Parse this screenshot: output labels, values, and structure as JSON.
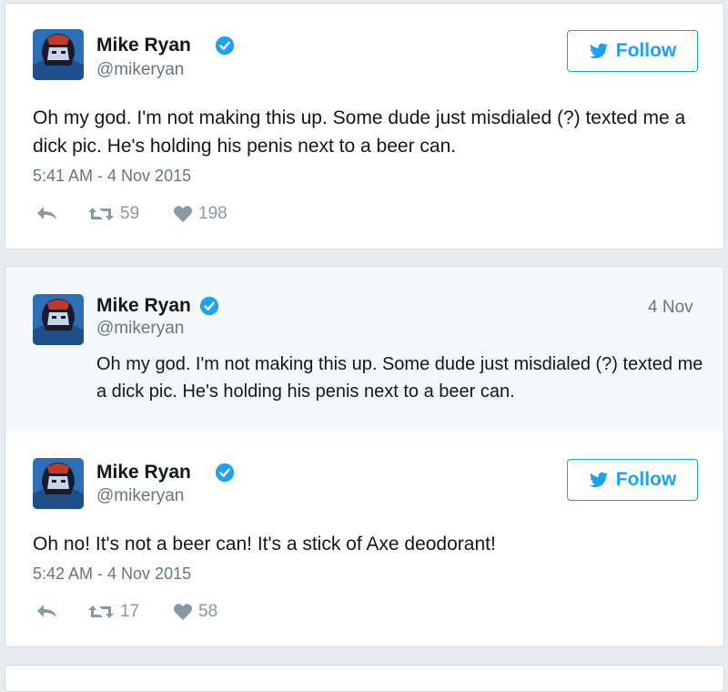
{
  "tweet1": {
    "name": "Mike Ryan",
    "handle": "@mikeryan",
    "follow_label": "Follow",
    "text": "Oh my god. I'm not making this up. Some dude just misdialed (?) texted me a dick pic. He's holding his penis next to a beer can.",
    "timestamp": "5:41 AM - 4 Nov 2015",
    "retweets": "59",
    "likes": "198",
    "icons": [
      "reply-icon",
      "retweet-icon",
      "heart-icon",
      "twitter-bird-icon",
      "verified-icon"
    ]
  },
  "quoted": {
    "name": "Mike Ryan",
    "handle": "@mikeryan",
    "date": "4 Nov",
    "text": "Oh my god. I'm not making this up. Some dude just misdialed (?) texted me a dick pic. He's holding his penis next to a beer can."
  },
  "tweet2": {
    "name": "Mike Ryan",
    "handle": "@mikeryan",
    "follow_label": "Follow",
    "text": "Oh no! It's not a beer can! It's a stick of Axe deodorant!",
    "timestamp": "5:42 AM - 4 Nov 2015",
    "retweets": "17",
    "likes": "58"
  },
  "colors": {
    "brand": "#1da1f2",
    "text": "#14171a",
    "muted": "#657786",
    "icon": "#8899a6",
    "background": "#e6ecf0"
  }
}
